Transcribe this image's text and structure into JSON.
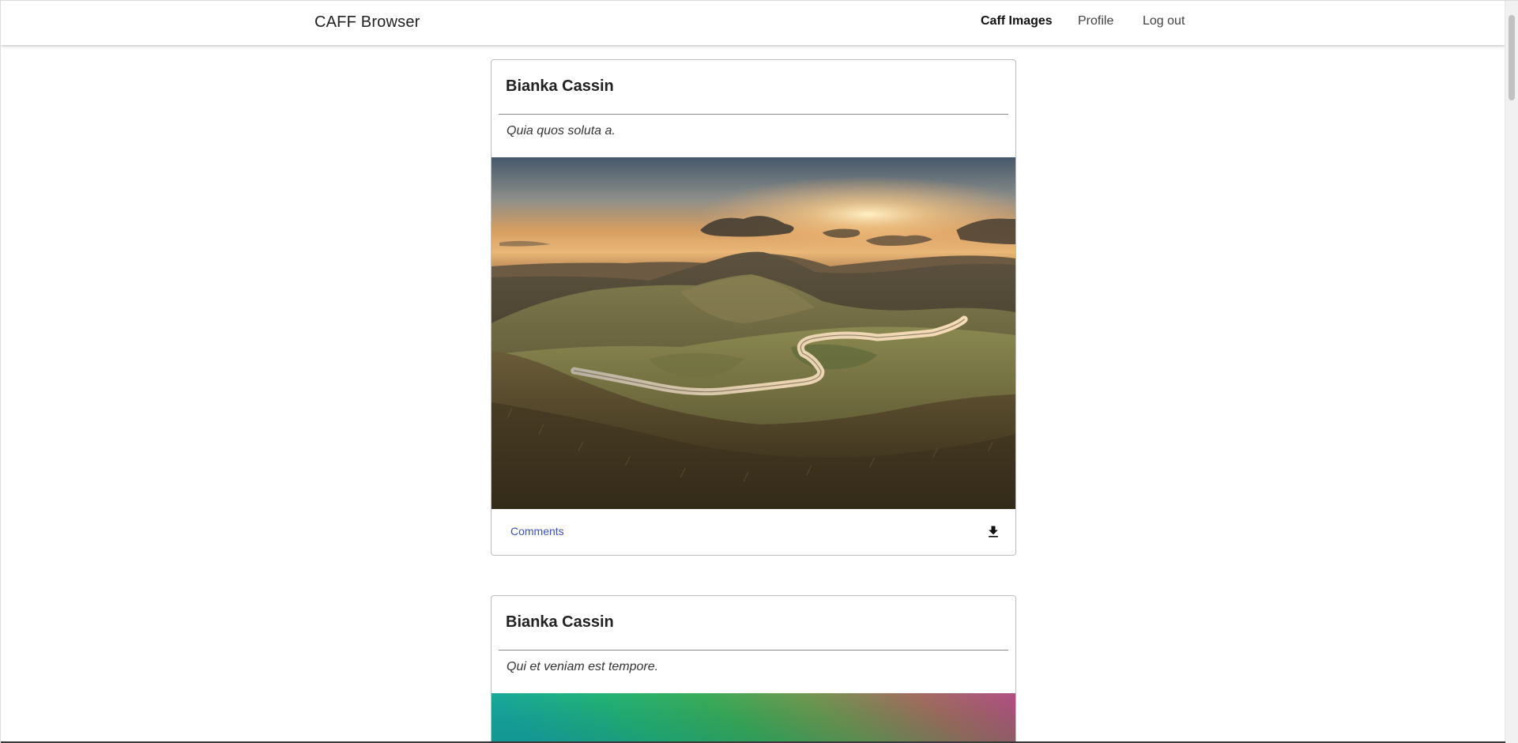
{
  "app": {
    "title": "CAFF Browser"
  },
  "nav": {
    "items": [
      {
        "label": "Caff Images",
        "active": true
      },
      {
        "label": "Profile",
        "active": false
      },
      {
        "label": "Log out",
        "active": false
      }
    ]
  },
  "feed": {
    "cards": [
      {
        "author": "Bianka Cassin",
        "description": "Quia quos soluta a.",
        "image": "landscape-photo-winding-road-sunset",
        "comments_label": "Comments",
        "download_icon": "download-icon"
      },
      {
        "author": "Bianka Cassin",
        "description": "Qui et veniam est tempore.",
        "image": "colorful-gradient-image"
      }
    ]
  },
  "colors": {
    "accent": "#3f51b5",
    "text_primary": "#212121",
    "card_border": "#bdbdbd"
  }
}
